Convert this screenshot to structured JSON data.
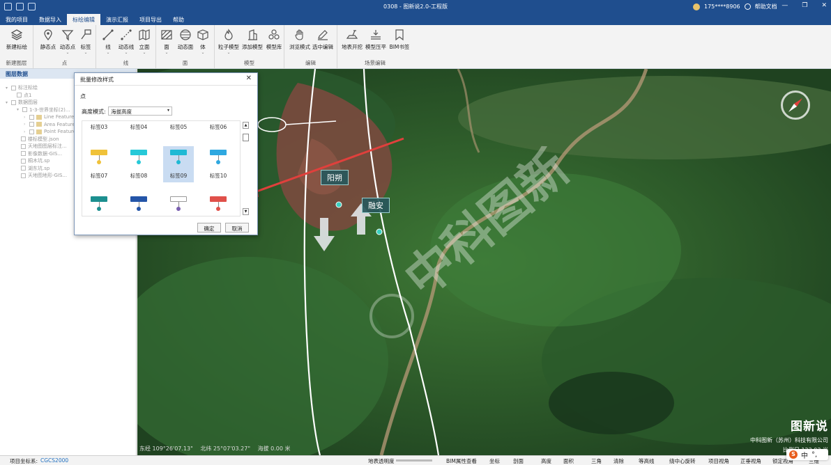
{
  "window": {
    "title": "0308 - 图新说2.0-工程版",
    "user": "175****8906",
    "help": "帮助文档"
  },
  "menu": [
    "我的项目",
    "数据导入",
    "标绘编辑",
    "演示汇报",
    "项目导出",
    "帮助"
  ],
  "ribbon": {
    "groups": [
      {
        "label": "新建图层",
        "buttons": [
          {
            "label": "新建标绘",
            "icon": "layers-icon"
          }
        ]
      },
      {
        "label": "点",
        "buttons": [
          {
            "label": "静态点",
            "icon": "pin-icon"
          },
          {
            "label": "动态点",
            "icon": "filter-icon"
          },
          {
            "label": "标签",
            "icon": "tag-icon"
          }
        ]
      },
      {
        "label": "线",
        "buttons": [
          {
            "label": "线",
            "icon": "line-icon"
          },
          {
            "label": "动态线",
            "icon": "dynamic-line-icon"
          },
          {
            "label": "立面",
            "icon": "wall-icon"
          }
        ]
      },
      {
        "label": "面",
        "buttons": [
          {
            "label": "面",
            "icon": "polygon-icon"
          },
          {
            "label": "动态面",
            "icon": "dynamic-surface-icon"
          },
          {
            "label": "体",
            "icon": "cube-icon"
          }
        ]
      },
      {
        "label": "模型",
        "buttons": [
          {
            "label": "粒子模型",
            "icon": "fire-icon"
          },
          {
            "label": "添加模型",
            "icon": "building-icon"
          },
          {
            "label": "模型库",
            "icon": "model-library-icon"
          }
        ]
      },
      {
        "label": "编辑",
        "buttons": [
          {
            "label": "浏览模式",
            "icon": "hand-icon"
          },
          {
            "label": "选中编辑",
            "icon": "pencil-icon"
          }
        ]
      },
      {
        "label": "场景编辑",
        "buttons": [
          {
            "label": "地表开挖",
            "icon": "excavate-icon"
          },
          {
            "label": "模型压平",
            "icon": "flatten-icon"
          },
          {
            "label": "BIM书签",
            "icon": "bookmark-icon"
          }
        ]
      }
    ]
  },
  "layers": {
    "title": "图层数据",
    "items": [
      "标注标绘",
      "点1",
      "数据图层",
      "1-3-世界坐标(2)...",
      "Line Feature...",
      "Area Feature...",
      "Point Feature...",
      "楼标模型.json",
      "天地图图层标注...",
      "影像数据-GIS...",
      "桐木坑.sp",
      "湖东坑.sp",
      "天地图地形-GIS..."
    ]
  },
  "dialog": {
    "title": "批量修改样式",
    "tab": "点",
    "height_mode_label": "高度模式:",
    "height_mode_value": "海拔高度",
    "styles": [
      {
        "name": "标签03"
      },
      {
        "name": "标签04"
      },
      {
        "name": "标签05"
      },
      {
        "name": "标签06"
      },
      {
        "name": "标签07",
        "color": "#f0c23a"
      },
      {
        "name": "标签08",
        "color": "#27c9d8"
      },
      {
        "name": "标签09",
        "color": "#1fb9d4"
      },
      {
        "name": "标签10",
        "color": "#2fa8e0"
      },
      {
        "name": "",
        "color": "#1c8f8f"
      },
      {
        "name": "",
        "color": "#2455a8"
      },
      {
        "name": "",
        "color": "#ffffff"
      },
      {
        "name": "",
        "color": "#e0504a"
      }
    ],
    "selected": "标签09",
    "ok": "确定",
    "cancel": "取消"
  },
  "map": {
    "labels": [
      "阳朔",
      "融安"
    ],
    "watermark": "中科图新",
    "coords": {
      "lng": "东经 109°26'07.13\"",
      "lat": "北纬 25°07'03.27\"",
      "alt": "海拔 0.00 米"
    },
    "brand": {
      "name": "图新说",
      "company": "中科图新（苏州）科技有限公司",
      "scale": "比例尺 123.03 米"
    }
  },
  "status": {
    "crs_label": "项目坐标系:",
    "crs_value": "CGCS2000",
    "transparency_label": "地表透明度",
    "tools": [
      "BIM属性查看",
      "坐标",
      "剖面",
      "高度",
      "面积",
      "三角",
      "清除",
      "等高线",
      "绕中心旋转",
      "项目视角",
      "正垂视角",
      "锁定视角",
      "三维"
    ]
  },
  "ime": {
    "mode": "中"
  }
}
